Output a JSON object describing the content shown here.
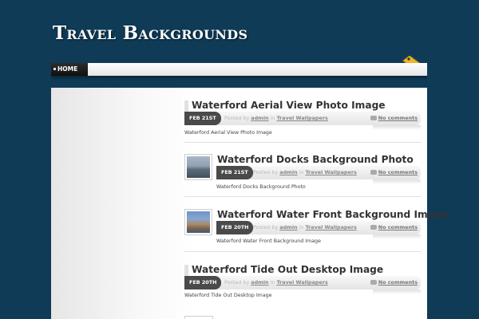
{
  "site": {
    "title": "Travel Backgrounds"
  },
  "nav": {
    "home_label": "HOME"
  },
  "posts": [
    {
      "title": "Waterford Aerial View Photo Image",
      "date": "FEB 21ST",
      "posted_by": "Posted by",
      "author": "admin",
      "in_word": "in",
      "category": "Travel Wallpapers",
      "comments": "No comments",
      "excerpt": "Waterford Aerial View Photo Image"
    },
    {
      "title": "Waterford Docks Background Photo",
      "date": "FEB 21ST",
      "posted_by": "Posted by",
      "author": "admin",
      "in_word": "in",
      "category": "Travel Wallpapers",
      "comments": "No comments",
      "excerpt": "Waterford Docks Background Photo"
    },
    {
      "title": "Waterford Water Front Background Image",
      "date": "FEB 20TH",
      "posted_by": "Posted by",
      "author": "admin",
      "in_word": "in",
      "category": "Travel Wallpapers",
      "comments": "No comments",
      "excerpt": "Waterford Water Front Background Image"
    },
    {
      "title": "Waterford Tide Out Desktop Image",
      "date": "FEB 20TH",
      "posted_by": "Posted by",
      "author": "admin",
      "in_word": "in",
      "category": "Travel Wallpapers",
      "comments": "No comments",
      "excerpt": "Waterford Tide Out Desktop Image"
    }
  ],
  "colors": {
    "background": "#0f3b57",
    "date_badge": "#4a4a4a",
    "title_text": "#333333",
    "rss_tag": "#f0b429"
  },
  "icons": {
    "rss": "rss-tag-icon",
    "comment": "comment-bubble-icon"
  }
}
